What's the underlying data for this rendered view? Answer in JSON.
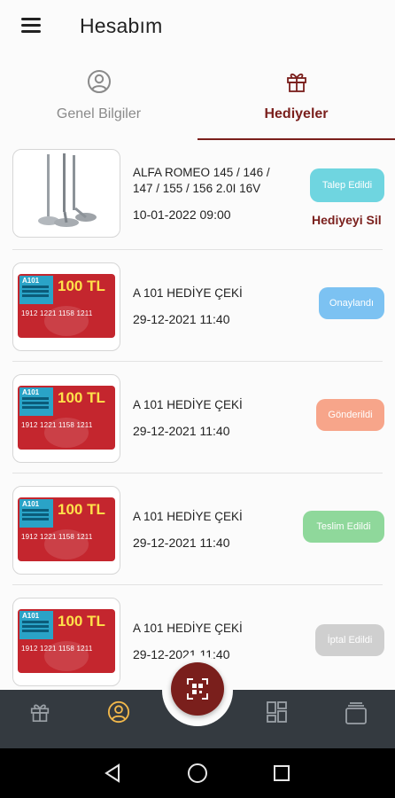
{
  "appbar": {
    "title": "Hesabım",
    "menu_icon": "hamburger-menu-icon"
  },
  "tabs": [
    {
      "label": "Genel Bilgiler",
      "icon": "user-circle-icon",
      "active": false
    },
    {
      "label": "Hediyeler",
      "icon": "gift-icon",
      "active": true
    }
  ],
  "gifts": [
    {
      "name": "ALFA ROMEO 145 / 146 / 147 / 155 / 156 2.0I 16V",
      "date": "10-01-2022 09:00",
      "status": "Talep Edildi",
      "status_color": "#6fd5e0",
      "action": "Hediyeyi Sil",
      "image": "engine-valves"
    },
    {
      "name": "A 101 HEDİYE ÇEKİ",
      "date": "29-12-2021 11:40",
      "status": "Onaylandı",
      "status_color": "#7cc2f2",
      "image": "gift-card"
    },
    {
      "name": "A 101 HEDİYE ÇEKİ",
      "date": "29-12-2021 11:40",
      "status": "Gönderildi",
      "status_color": "#f7a58a",
      "image": "gift-card"
    },
    {
      "name": "A 101 HEDİYE ÇEKİ",
      "date": "29-12-2021 11:40",
      "status": "Teslim Edildi",
      "status_color": "#8fd89b",
      "image": "gift-card"
    },
    {
      "name": "A 101 HEDİYE ÇEKİ",
      "date": "29-12-2021 11:40",
      "status": "İptal Edildi",
      "status_color": "#cfcfcf",
      "image": "gift-card"
    }
  ],
  "gift_card": {
    "brand": "A101",
    "amount": "100 TL",
    "numbers": "1912 1221  1158  1211"
  },
  "colors": {
    "primary": "#7a1f1c",
    "nav_bg": "#343a40",
    "nav_active": "#f2b84b"
  },
  "bottom_nav": [
    {
      "icon": "gift-icon",
      "active": false
    },
    {
      "icon": "user-circle-icon",
      "active": true
    },
    {
      "icon": "qr-scan-icon",
      "active": false
    },
    {
      "icon": "dashboard-grid-icon",
      "active": false
    },
    {
      "icon": "cards-stack-icon",
      "active": false
    }
  ],
  "system_nav": [
    "back-icon",
    "home-icon",
    "recents-icon"
  ]
}
